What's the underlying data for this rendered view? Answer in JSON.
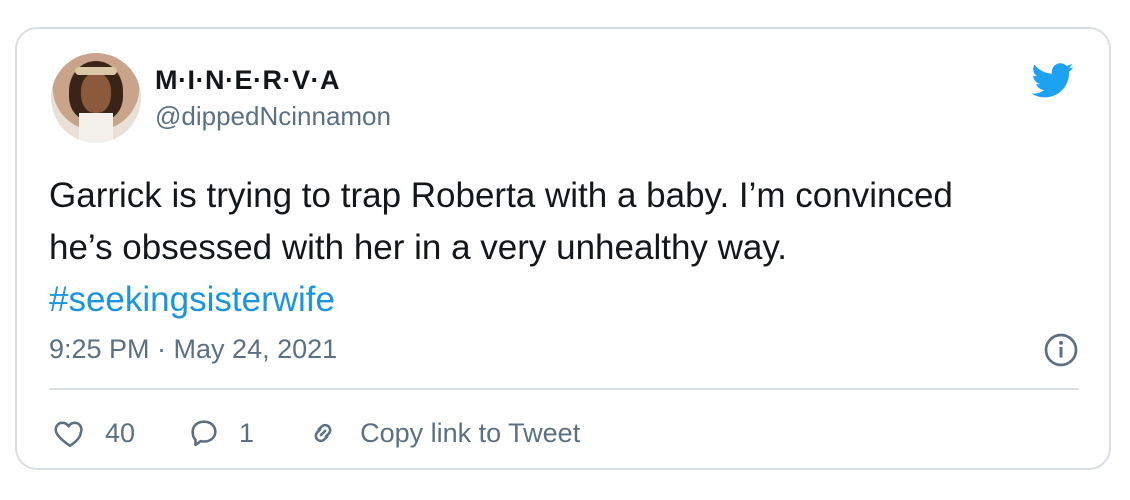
{
  "user": {
    "display_name": "M·I·N·E·R·V·A",
    "handle": "@dippedNcinnamon"
  },
  "tweet": {
    "text_line1": "Garrick is trying to trap Roberta with a baby. I’m convinced",
    "text_line2": "he’s obsessed with her in a very unhealthy way.",
    "hashtag": "#seekingsisterwife",
    "timestamp": "9:25 PM · May 24, 2021"
  },
  "actions": {
    "likes": "40",
    "replies": "1",
    "copy_link_label": "Copy link to Tweet"
  },
  "icons": {
    "brand": "twitter-bird-icon",
    "like": "heart-icon",
    "reply": "speech-bubble-icon",
    "link": "link-icon",
    "info": "info-icon"
  },
  "colors": {
    "brand": "#1da1f2",
    "hashtag": "#1b95e0",
    "text": "#14171a",
    "muted": "#5b7083",
    "border": "#d9dee3"
  }
}
